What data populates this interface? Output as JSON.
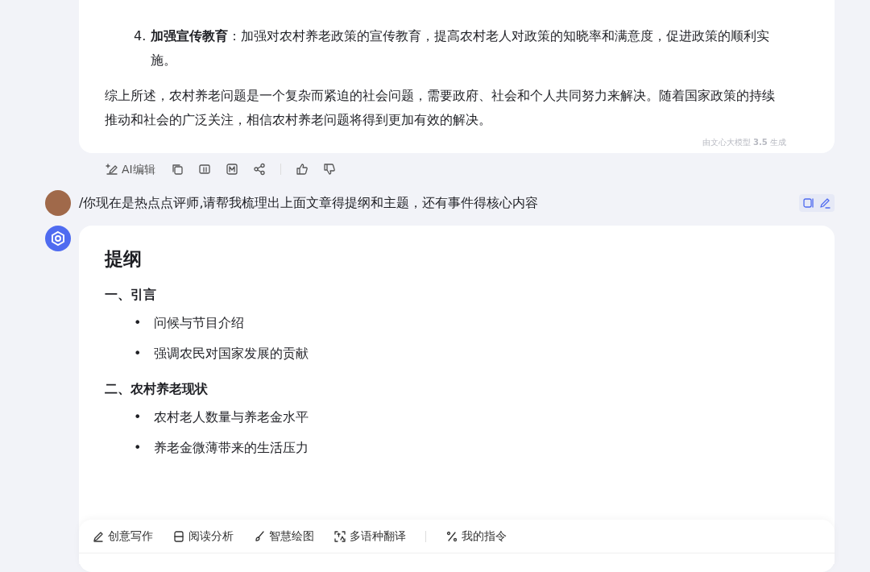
{
  "previous_answer": {
    "list_items": [
      {
        "number": "4.",
        "text": "**加强宣传教育**：加强对农村养老政策的宣传教育，提高农村老人对政策的知晓率和满意度，促进政策的顺利实施。"
      }
    ],
    "summary": "综上所述，农村养老问题是一个复杂而紧迫的社会问题，需要政府、社会和个人共同努力来解决。随着国家政策的持续推动和社会的广泛关注，相信农村养老问题将得到更加有效的解决。",
    "footer": "由文心大模型 **3.5** 生成"
  },
  "action_bar": {
    "edit_label": "AI编辑"
  },
  "user_message": {
    "text": "/你现在是热点点评师,请帮我梳理出上面文章得提纲和主题，还有事件得核心内容"
  },
  "answer": {
    "heading": "提纲",
    "sections": [
      {
        "title": "一、引言",
        "bullets": [
          {
            "marker": "•",
            "text": "问候与节目介绍"
          },
          {
            "marker": "•",
            "text": "强调农民对国家发展的贡献"
          }
        ]
      },
      {
        "title": "二、农村养老现状",
        "bullets": [
          {
            "marker": "•",
            "text": "农村老人数量与养老金水平"
          },
          {
            "marker": "•",
            "text": "养老金微薄带来的生活压力"
          }
        ]
      }
    ]
  },
  "toolbar": {
    "tools": [
      {
        "kind": "pen",
        "label": "创意写作"
      },
      {
        "kind": "doc",
        "label": "阅读分析"
      },
      {
        "kind": "brush",
        "label": "智慧绘图"
      },
      {
        "kind": "translate",
        "label": "多语种翻译"
      }
    ],
    "my_commands": "我的指令"
  }
}
